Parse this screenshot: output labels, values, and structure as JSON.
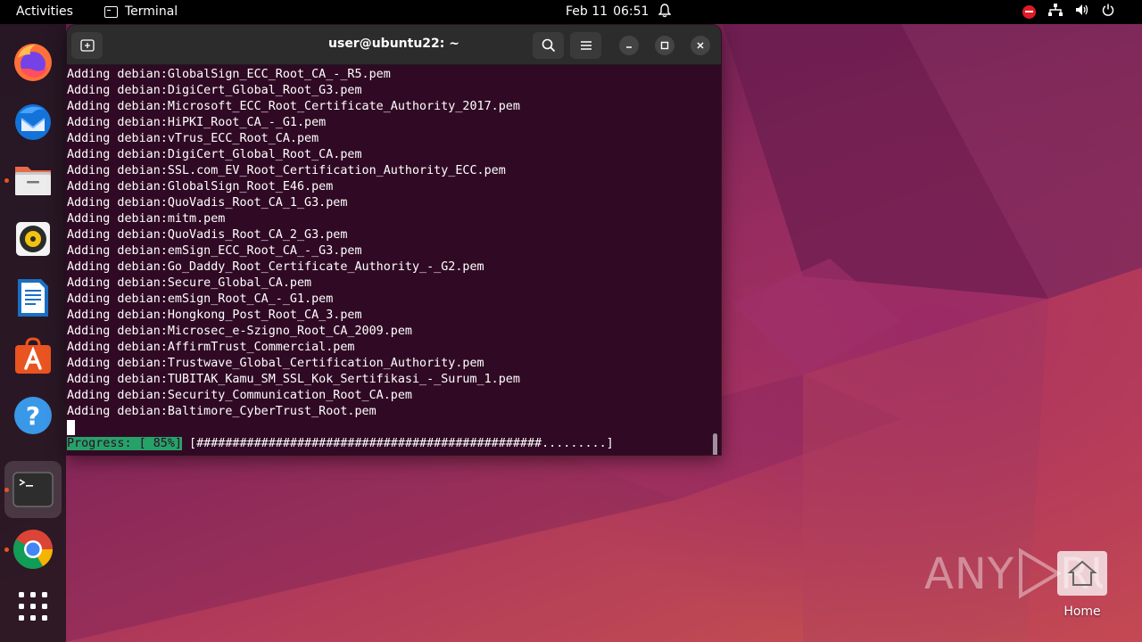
{
  "topbar": {
    "activities": "Activities",
    "app_name": "Terminal",
    "date": "Feb 11",
    "time": "06:51"
  },
  "dock": {
    "items": [
      {
        "name": "firefox-icon"
      },
      {
        "name": "thunderbird-icon"
      },
      {
        "name": "files-icon"
      },
      {
        "name": "rhythmbox-icon"
      },
      {
        "name": "libreoffice-writer-icon"
      },
      {
        "name": "app-center-icon"
      },
      {
        "name": "help-icon"
      },
      {
        "name": "terminal-icon"
      },
      {
        "name": "chrome-icon"
      },
      {
        "name": "show-apps-icon"
      }
    ]
  },
  "terminal": {
    "title": "user@ubuntu22: ~",
    "lines": [
      "Adding debian:GlobalSign_ECC_Root_CA_-_R5.pem",
      "Adding debian:DigiCert_Global_Root_G3.pem",
      "Adding debian:Microsoft_ECC_Root_Certificate_Authority_2017.pem",
      "Adding debian:HiPKI_Root_CA_-_G1.pem",
      "Adding debian:vTrus_ECC_Root_CA.pem",
      "Adding debian:DigiCert_Global_Root_CA.pem",
      "Adding debian:SSL.com_EV_Root_Certification_Authority_ECC.pem",
      "Adding debian:GlobalSign_Root_E46.pem",
      "Adding debian:QuoVadis_Root_CA_1_G3.pem",
      "Adding debian:mitm.pem",
      "Adding debian:QuoVadis_Root_CA_2_G3.pem",
      "Adding debian:emSign_ECC_Root_CA_-_G3.pem",
      "Adding debian:Go_Daddy_Root_Certificate_Authority_-_G2.pem",
      "Adding debian:Secure_Global_CA.pem",
      "Adding debian:emSign_Root_CA_-_G1.pem",
      "Adding debian:Hongkong_Post_Root_CA_3.pem",
      "Adding debian:Microsec_e-Szigno_Root_CA_2009.pem",
      "Adding debian:AffirmTrust_Commercial.pem",
      "Adding debian:Trustwave_Global_Certification_Authority.pem",
      "Adding debian:TUBITAK_Kamu_SM_SSL_Kok_Sertifikasi_-_Surum_1.pem",
      "Adding debian:Security_Communication_Root_CA.pem",
      "Adding debian:Baltimore_CyberTrust_Root.pem"
    ],
    "progress_label": "Progress: [ 85%]",
    "progress_bar": " [################################################.........]",
    "progress_percent": 85
  },
  "desktop": {
    "home_label": "Home",
    "watermark": "ANY RUN"
  },
  "colors": {
    "terminal_bg": "#300a24",
    "progress_green": "#26a269",
    "accent": "#e95420"
  }
}
